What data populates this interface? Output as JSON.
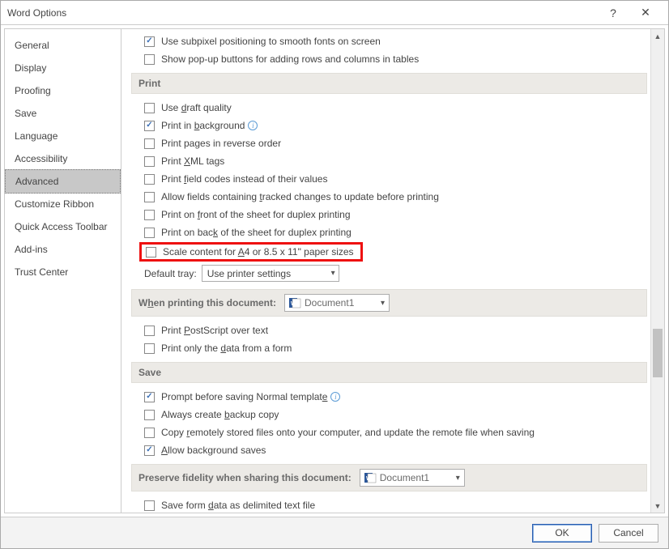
{
  "window": {
    "title": "Word Options",
    "help_tooltip": "?",
    "close_tooltip": "✕"
  },
  "sidebar": {
    "items": [
      {
        "label": "General"
      },
      {
        "label": "Display"
      },
      {
        "label": "Proofing"
      },
      {
        "label": "Save"
      },
      {
        "label": "Language"
      },
      {
        "label": "Accessibility"
      },
      {
        "label": "Advanced",
        "selected": true
      },
      {
        "label": "Customize Ribbon"
      },
      {
        "label": "Quick Access Toolbar"
      },
      {
        "label": "Add-ins"
      },
      {
        "label": "Trust Center"
      }
    ]
  },
  "top_checks": [
    {
      "label_html": "Use subpixel positioning to smooth fonts on screen",
      "checked": true
    },
    {
      "label_html": "Show pop-up buttons for adding rows and columns in tables",
      "checked": false
    }
  ],
  "sections": {
    "print": {
      "title": "Print",
      "items": [
        {
          "label": "Use draft quality",
          "u": "d",
          "pre": "Use ",
          "post": "raft quality",
          "checked": false
        },
        {
          "label": "Print in background",
          "u": "b",
          "pre": "Print in ",
          "post": "ackground",
          "checked": true,
          "info": true
        },
        {
          "label": "Print pages in reverse order",
          "u": "",
          "pre": "Print pages in reverse order",
          "post": "",
          "checked": false
        },
        {
          "label": "Print XML tags",
          "u": "X",
          "pre": "Print ",
          "post": "ML tags",
          "checked": false
        },
        {
          "label": "Print field codes instead of their values",
          "u": "f",
          "pre": "Print ",
          "post": "ield codes instead of their values",
          "checked": false
        },
        {
          "label": "Allow fields containing tracked changes to update before printing",
          "u": "t",
          "pre": "Allow fields containing ",
          "post": "racked changes to update before printing",
          "checked": false
        },
        {
          "label": "Print on front of the sheet for duplex printing",
          "u": "f",
          "pre": "Print on ",
          "post": "ront of the sheet for duplex printing",
          "checked": false
        },
        {
          "label": "Print on back of the sheet for duplex printing",
          "u": "k",
          "pre": "Print on bac",
          "post": " of the sheet for duplex printing",
          "checked": false
        },
        {
          "label": "Scale content for A4 or 8.5 x 11\" paper sizes",
          "u": "A",
          "pre": "Scale content for ",
          "post": "4 or 8.5 x 11\" paper sizes",
          "checked": false,
          "highlight": true
        }
      ],
      "default_tray_label": "Default tray:",
      "default_tray_value": "Use printer settings"
    },
    "print_doc": {
      "title_html": "When printing this document:",
      "u": "h",
      "title_pre": "W",
      "title_post": "en printing this document:",
      "doc_name": "Document1",
      "items": [
        {
          "pre": "Print ",
          "u": "P",
          "post": "ostScript over text",
          "checked": false
        },
        {
          "pre": "Print only the ",
          "u": "d",
          "post": "ata from a form",
          "checked": false
        }
      ]
    },
    "save": {
      "title": "Save",
      "items": [
        {
          "pre": "Prompt before saving Normal templat",
          "u": "e",
          "post": "",
          "checked": true,
          "info": true
        },
        {
          "pre": "Always create ",
          "u": "b",
          "post": "ackup copy",
          "checked": false
        },
        {
          "pre": "Copy ",
          "u": "r",
          "post": "emotely stored files onto your computer, and update the remote file when saving",
          "checked": false
        },
        {
          "pre": "",
          "u": "A",
          "post": "llow background saves",
          "checked": true
        }
      ]
    },
    "preserve": {
      "title": "Preserve fidelity when sharing this document:",
      "doc_name": "Document1",
      "items": [
        {
          "pre": "Save form ",
          "u": "d",
          "post": "ata as delimited text file",
          "checked": false
        }
      ]
    }
  },
  "footer": {
    "ok": "OK",
    "cancel": "Cancel"
  }
}
